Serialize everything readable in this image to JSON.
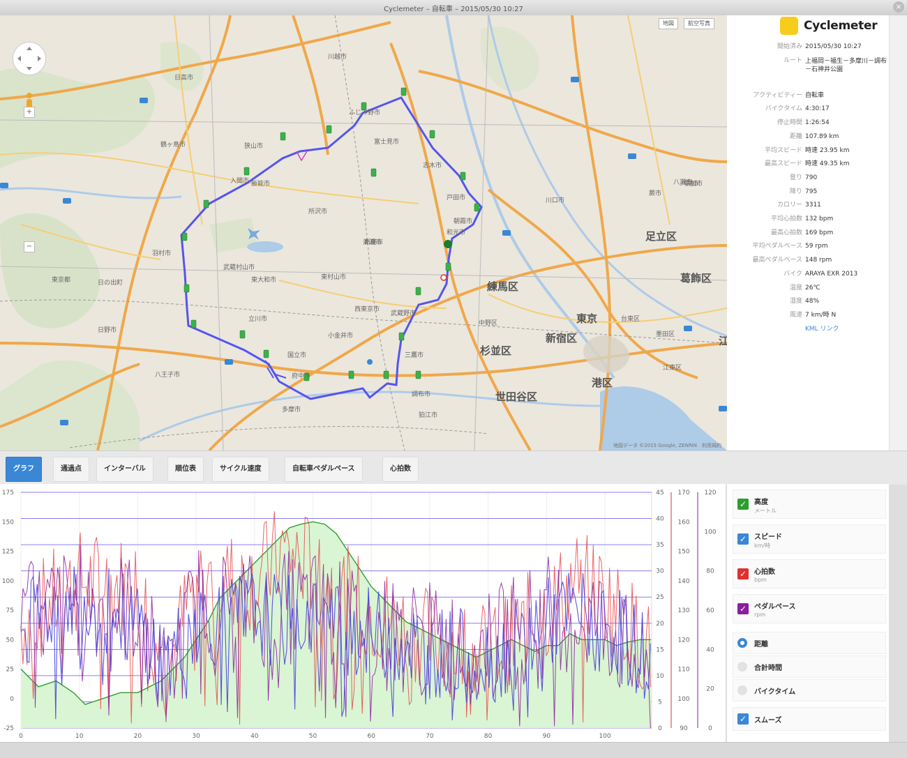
{
  "window": {
    "title": "Cyclemeter – 自転車 – 2015/05/30 10:27"
  },
  "map": {
    "map_btn": "地図",
    "satellite_btn": "航空写真",
    "zoom_in": "+",
    "zoom_out": "−",
    "copyright": "地図データ ©2015 Google, ZENRIN　利用規約",
    "labels": [
      {
        "text": "川越市",
        "big": false
      },
      {
        "text": "日高市",
        "big": false
      },
      {
        "text": "鶴ヶ島市",
        "big": false
      },
      {
        "text": "ふじみ野市",
        "big": false
      },
      {
        "text": "富士見市",
        "big": false
      },
      {
        "text": "志木市",
        "big": false
      },
      {
        "text": "狭山市",
        "big": false
      },
      {
        "text": "飯能市",
        "big": false
      },
      {
        "text": "入間市",
        "big": false
      },
      {
        "text": "所沢市",
        "big": false
      },
      {
        "text": "新座市",
        "big": false
      },
      {
        "text": "朝霞市",
        "big": false
      },
      {
        "text": "和光市",
        "big": false
      },
      {
        "text": "戸田市",
        "big": false
      },
      {
        "text": "川口市",
        "big": false
      },
      {
        "text": "蕨市",
        "big": false
      },
      {
        "text": "草加市",
        "big": false
      },
      {
        "text": "八潮市",
        "big": false
      },
      {
        "text": "羽村市",
        "big": false
      },
      {
        "text": "武蔵村山市",
        "big": false
      },
      {
        "text": "東大和市",
        "big": false
      },
      {
        "text": "東村山市",
        "big": false
      },
      {
        "text": "清瀬市",
        "big": false
      },
      {
        "text": "日の出町",
        "big": false
      },
      {
        "text": "立川市",
        "big": false
      },
      {
        "text": "西東京市",
        "big": false
      },
      {
        "text": "小金井市",
        "big": false
      },
      {
        "text": "武蔵野市",
        "big": false
      },
      {
        "text": "三鷹市",
        "big": false
      },
      {
        "text": "国立市",
        "big": false
      },
      {
        "text": "府中市",
        "big": false
      },
      {
        "text": "調布市",
        "big": false
      },
      {
        "text": "多摩市",
        "big": false
      },
      {
        "text": "狛江市",
        "big": false
      },
      {
        "text": "八王子市",
        "big": false
      },
      {
        "text": "日野市",
        "big": false
      },
      {
        "text": "中野区",
        "big": false
      },
      {
        "text": "台東区",
        "big": false
      },
      {
        "text": "江東区",
        "big": false
      },
      {
        "text": "墨田区",
        "big": false
      },
      {
        "text": "東京都",
        "big": false
      },
      {
        "text": "八潮市",
        "big": false
      },
      {
        "text": "練馬区",
        "big": true
      },
      {
        "text": "杉並区",
        "big": true
      },
      {
        "text": "新宿区",
        "big": true
      },
      {
        "text": "世田谷区",
        "big": true
      },
      {
        "text": "足立区",
        "big": true
      },
      {
        "text": "葛飾区",
        "big": true
      },
      {
        "text": "東京",
        "big": true
      },
      {
        "text": "港区",
        "big": true
      },
      {
        "text": "江",
        "big": true
      }
    ]
  },
  "sidebar": {
    "app_name": "Cyclemeter",
    "stats": [
      {
        "k": "開始済み",
        "v": "2015/05/30 10:27"
      },
      {
        "k": "ルート",
        "v": "上福岡－福生－多摩川－調布－石神井公園"
      },
      {
        "k": "アクティビティー",
        "v": "自転車"
      },
      {
        "k": "バイクタイム",
        "v": "4:30:17"
      },
      {
        "k": "停止時間",
        "v": "1:26:54"
      },
      {
        "k": "距離",
        "v": "107.89 km"
      },
      {
        "k": "平均スピード",
        "v": "時速 23.95 km"
      },
      {
        "k": "最高スピード",
        "v": "時速 49.35 km"
      },
      {
        "k": "登り",
        "v": "790"
      },
      {
        "k": "降り",
        "v": "795"
      },
      {
        "k": "カロリー",
        "v": "3311"
      },
      {
        "k": "平均心拍数",
        "v": "132 bpm"
      },
      {
        "k": "最高心拍数",
        "v": "169 bpm"
      },
      {
        "k": "平均ペダルペース",
        "v": "59 rpm"
      },
      {
        "k": "最高ペダルペース",
        "v": "148 rpm"
      },
      {
        "k": "バイク",
        "v": "ARAYA EXR 2013"
      },
      {
        "k": "温度",
        "v": "26℃"
      },
      {
        "k": "湿度",
        "v": "48%"
      },
      {
        "k": "風速",
        "v": "7 km/時 N"
      }
    ],
    "kml_link": "KML リンク"
  },
  "tabs": [
    "グラフ",
    "通過点",
    "インターバル",
    "順位表",
    "サイクル速度",
    "自転車ペダルペース",
    "心拍数"
  ],
  "legend": {
    "series": [
      {
        "name": "高度",
        "unit": "メートル",
        "color": "#2e9e2e"
      },
      {
        "name": "スピード",
        "unit": "km/時",
        "color": "#3a87d6"
      },
      {
        "name": "心拍数",
        "unit": "bpm",
        "color": "#e03030"
      },
      {
        "name": "ペダルペース",
        "unit": "rpm",
        "color": "#8a1e9e"
      }
    ],
    "x_options": [
      {
        "name": "距離",
        "selected": true
      },
      {
        "name": "合計時間",
        "selected": false
      },
      {
        "name": "バイクタイム",
        "selected": false
      }
    ],
    "smooth": {
      "name": "スムーズ",
      "checked": true
    }
  },
  "chart_data": {
    "type": "line",
    "x_axis_ticks": [
      "0",
      "10",
      "20",
      "30",
      "40",
      "50",
      "60",
      "70",
      "80",
      "90",
      "100"
    ],
    "xlim": [
      0,
      108
    ],
    "axes": {
      "altitude": {
        "ticks": [
          "-25",
          "0",
          "25",
          "50",
          "75",
          "100",
          "125",
          "150",
          "175"
        ],
        "ylim": [
          -25,
          175
        ]
      },
      "speed": {
        "ticks": [
          "0",
          "5",
          "10",
          "15",
          "20",
          "25",
          "30",
          "35",
          "40",
          "45"
        ],
        "ylim": [
          0,
          45
        ]
      },
      "heart_rate": {
        "ticks": [
          "90",
          "100",
          "110",
          "120",
          "130",
          "140",
          "150",
          "160",
          "170"
        ],
        "ylim": [
          90,
          170
        ]
      },
      "cadence": {
        "ticks": [
          "0",
          "20",
          "40",
          "60",
          "80",
          "100",
          "120"
        ],
        "ylim": [
          0,
          120
        ]
      }
    },
    "altitude_series": [
      [
        0,
        25
      ],
      [
        3,
        10
      ],
      [
        6,
        15
      ],
      [
        9,
        5
      ],
      [
        11,
        -5
      ],
      [
        14,
        0
      ],
      [
        17,
        5
      ],
      [
        20,
        5
      ],
      [
        22,
        10
      ],
      [
        24,
        15
      ],
      [
        26,
        25
      ],
      [
        28,
        35
      ],
      [
        30,
        50
      ],
      [
        32,
        65
      ],
      [
        34,
        85
      ],
      [
        36,
        95
      ],
      [
        38,
        105
      ],
      [
        40,
        115
      ],
      [
        42,
        125
      ],
      [
        44,
        135
      ],
      [
        46,
        145
      ],
      [
        48,
        148
      ],
      [
        50,
        150
      ],
      [
        52,
        148
      ],
      [
        54,
        140
      ],
      [
        56,
        125
      ],
      [
        58,
        110
      ],
      [
        60,
        95
      ],
      [
        62,
        85
      ],
      [
        64,
        75
      ],
      [
        66,
        65
      ],
      [
        68,
        60
      ],
      [
        70,
        55
      ],
      [
        72,
        50
      ],
      [
        74,
        45
      ],
      [
        76,
        40
      ],
      [
        78,
        35
      ],
      [
        80,
        40
      ],
      [
        82,
        45
      ],
      [
        84,
        50
      ],
      [
        86,
        45
      ],
      [
        88,
        40
      ],
      [
        90,
        45
      ],
      [
        92,
        45
      ],
      [
        94,
        55
      ],
      [
        96,
        50
      ],
      [
        98,
        50
      ],
      [
        100,
        50
      ],
      [
        102,
        45
      ],
      [
        104,
        48
      ],
      [
        106,
        50
      ],
      [
        107.9,
        50
      ]
    ],
    "speed_trend": [
      [
        0,
        18
      ],
      [
        5,
        23
      ],
      [
        10,
        25
      ],
      [
        15,
        22
      ],
      [
        20,
        20
      ],
      [
        25,
        12
      ],
      [
        30,
        21
      ],
      [
        35,
        20
      ],
      [
        40,
        22
      ],
      [
        45,
        20
      ],
      [
        50,
        22
      ],
      [
        55,
        19
      ],
      [
        60,
        18
      ],
      [
        65,
        17
      ],
      [
        70,
        15
      ],
      [
        75,
        14
      ],
      [
        80,
        13
      ],
      [
        85,
        16
      ],
      [
        90,
        20
      ],
      [
        95,
        22
      ],
      [
        100,
        20
      ],
      [
        105,
        15
      ],
      [
        107.9,
        14
      ]
    ],
    "heart_rate_trend": [
      [
        0,
        125
      ],
      [
        10,
        140
      ],
      [
        20,
        138
      ],
      [
        25,
        110
      ],
      [
        30,
        140
      ],
      [
        40,
        140
      ],
      [
        45,
        150
      ],
      [
        50,
        145
      ],
      [
        55,
        135
      ],
      [
        60,
        130
      ],
      [
        70,
        120
      ],
      [
        80,
        115
      ],
      [
        90,
        130
      ],
      [
        95,
        140
      ],
      [
        100,
        135
      ],
      [
        107.9,
        115
      ]
    ],
    "cadence_trend": [
      [
        0,
        55
      ],
      [
        10,
        65
      ],
      [
        20,
        60
      ],
      [
        25,
        20
      ],
      [
        30,
        65
      ],
      [
        40,
        60
      ],
      [
        50,
        62
      ],
      [
        60,
        50
      ],
      [
        70,
        45
      ],
      [
        80,
        40
      ],
      [
        90,
        60
      ],
      [
        100,
        55
      ],
      [
        107.9,
        20
      ]
    ]
  }
}
